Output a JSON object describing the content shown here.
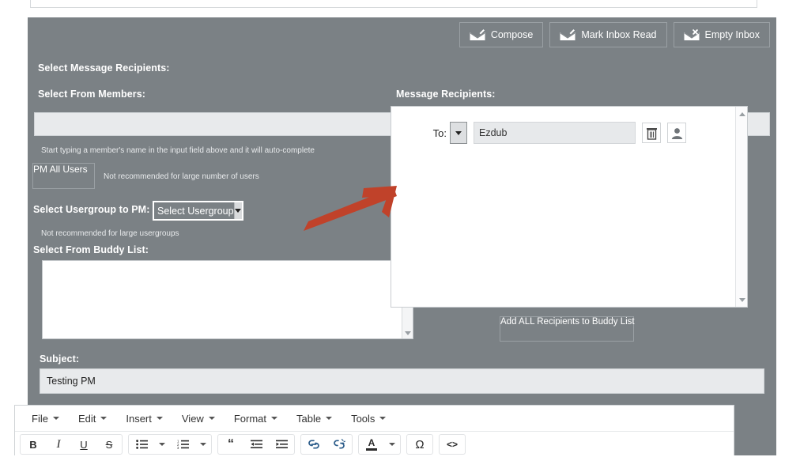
{
  "toolbar": {
    "buttons": [
      {
        "label": "Compose",
        "icon": "compose-envelope-icon"
      },
      {
        "label": "Mark Inbox Read",
        "icon": "mark-read-envelope-icon"
      },
      {
        "label": "Empty Inbox",
        "icon": "empty-inbox-envelope-icon"
      }
    ]
  },
  "left": {
    "title": "Select Message Recipients:",
    "members_label": "Select From Members:",
    "members_value": "",
    "members_placeholder": "",
    "members_hint": "Start typing a member's name in the input field above and it will auto-complete",
    "pm_all_label": "PM All Users",
    "pm_all_hint": "Not recommended for large number of users",
    "usergroup_label": "Select Usergroup to PM:",
    "usergroup_value": "Select Usergroup",
    "usergroup_hint": "Not recommended for large usergroups",
    "buddy_label": "Select From Buddy List:",
    "buddy_value": ""
  },
  "recipients": {
    "label": "Message Recipients:",
    "rows": [
      {
        "to_label": "To:",
        "name": "Ezdub",
        "delete_icon": "trash-icon",
        "profile_icon": "user-avatar-icon"
      }
    ],
    "add_all_label": "Add ALL Recipients to Buddy List"
  },
  "subject": {
    "label": "Subject:",
    "value": "Testing PM"
  },
  "editor": {
    "menus": [
      "File",
      "Edit",
      "Insert",
      "View",
      "Format",
      "Table",
      "Tools"
    ],
    "groups": [
      [
        {
          "icon": "bold-icon",
          "glyph": "B"
        },
        {
          "icon": "italic-icon",
          "glyph": "I"
        },
        {
          "icon": "underline-icon",
          "glyph": "U"
        },
        {
          "icon": "strikethrough-icon",
          "glyph": "S"
        }
      ],
      [
        {
          "icon": "bullet-list-icon",
          "glyph": ""
        },
        {
          "icon": "bullet-list-dropdown-icon",
          "glyph": ""
        },
        {
          "icon": "numbered-list-icon",
          "glyph": ""
        },
        {
          "icon": "numbered-list-dropdown-icon",
          "glyph": ""
        }
      ],
      [
        {
          "icon": "blockquote-icon",
          "glyph": "“"
        },
        {
          "icon": "outdent-icon",
          "glyph": ""
        },
        {
          "icon": "indent-icon",
          "glyph": ""
        }
      ],
      [
        {
          "icon": "link-icon",
          "glyph": ""
        },
        {
          "icon": "unlink-icon",
          "glyph": ""
        }
      ],
      [
        {
          "icon": "text-color-icon",
          "glyph": "A"
        },
        {
          "icon": "text-color-dropdown-icon",
          "glyph": ""
        }
      ],
      [
        {
          "icon": "special-character-icon",
          "glyph": "Ω"
        }
      ],
      [
        {
          "icon": "source-code-icon",
          "glyph": "<>"
        }
      ]
    ]
  },
  "annotation": {
    "arrow_color": "#c0422a",
    "arrow_name": "red-pointer-arrow"
  },
  "colors": {
    "panel_bg": "#7b8185",
    "field_bg": "#e8eaec"
  }
}
